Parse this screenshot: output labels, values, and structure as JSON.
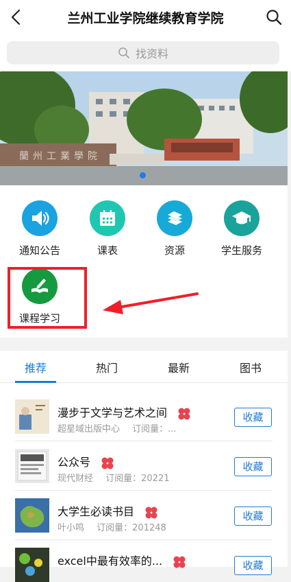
{
  "header": {
    "title": "兰州工业学院继续教育学院"
  },
  "search": {
    "placeholder": "找资料"
  },
  "banner": {
    "gate_sign": "蘭州工業學院"
  },
  "menu": {
    "items": [
      {
        "label": "通知公告",
        "color": "#1aa3e0",
        "icon": "speaker-icon"
      },
      {
        "label": "课表",
        "color": "#20c7b0",
        "icon": "calendar-icon"
      },
      {
        "label": "资源",
        "color": "#17a9d8",
        "icon": "books-icon"
      },
      {
        "label": "学生服务",
        "color": "#1aa39a",
        "icon": "graduation-cap-icon"
      },
      {
        "label": "课程学习",
        "color": "#169a3f",
        "icon": "book-pen-icon"
      }
    ]
  },
  "tabs": [
    {
      "label": "推荐"
    },
    {
      "label": "热门"
    },
    {
      "label": "最新"
    },
    {
      "label": "图书"
    }
  ],
  "list": {
    "fav_label": "收藏",
    "items": [
      {
        "title": "漫步于文学与艺术之间",
        "source": "超星域出版中心",
        "subs": "订阅量：..."
      },
      {
        "title": "公众号",
        "source": "现代财经",
        "subs": "订阅量：20221"
      },
      {
        "title": "大学生必读书目",
        "source": "叶小鸣",
        "subs": "订阅量：201248"
      },
      {
        "title": "excel中最有效率的...",
        "source": "",
        "subs": ""
      }
    ]
  },
  "colors": {
    "accent": "#1e7bd6",
    "highlight": "#ee1f2a",
    "badge": "#e8434f"
  }
}
